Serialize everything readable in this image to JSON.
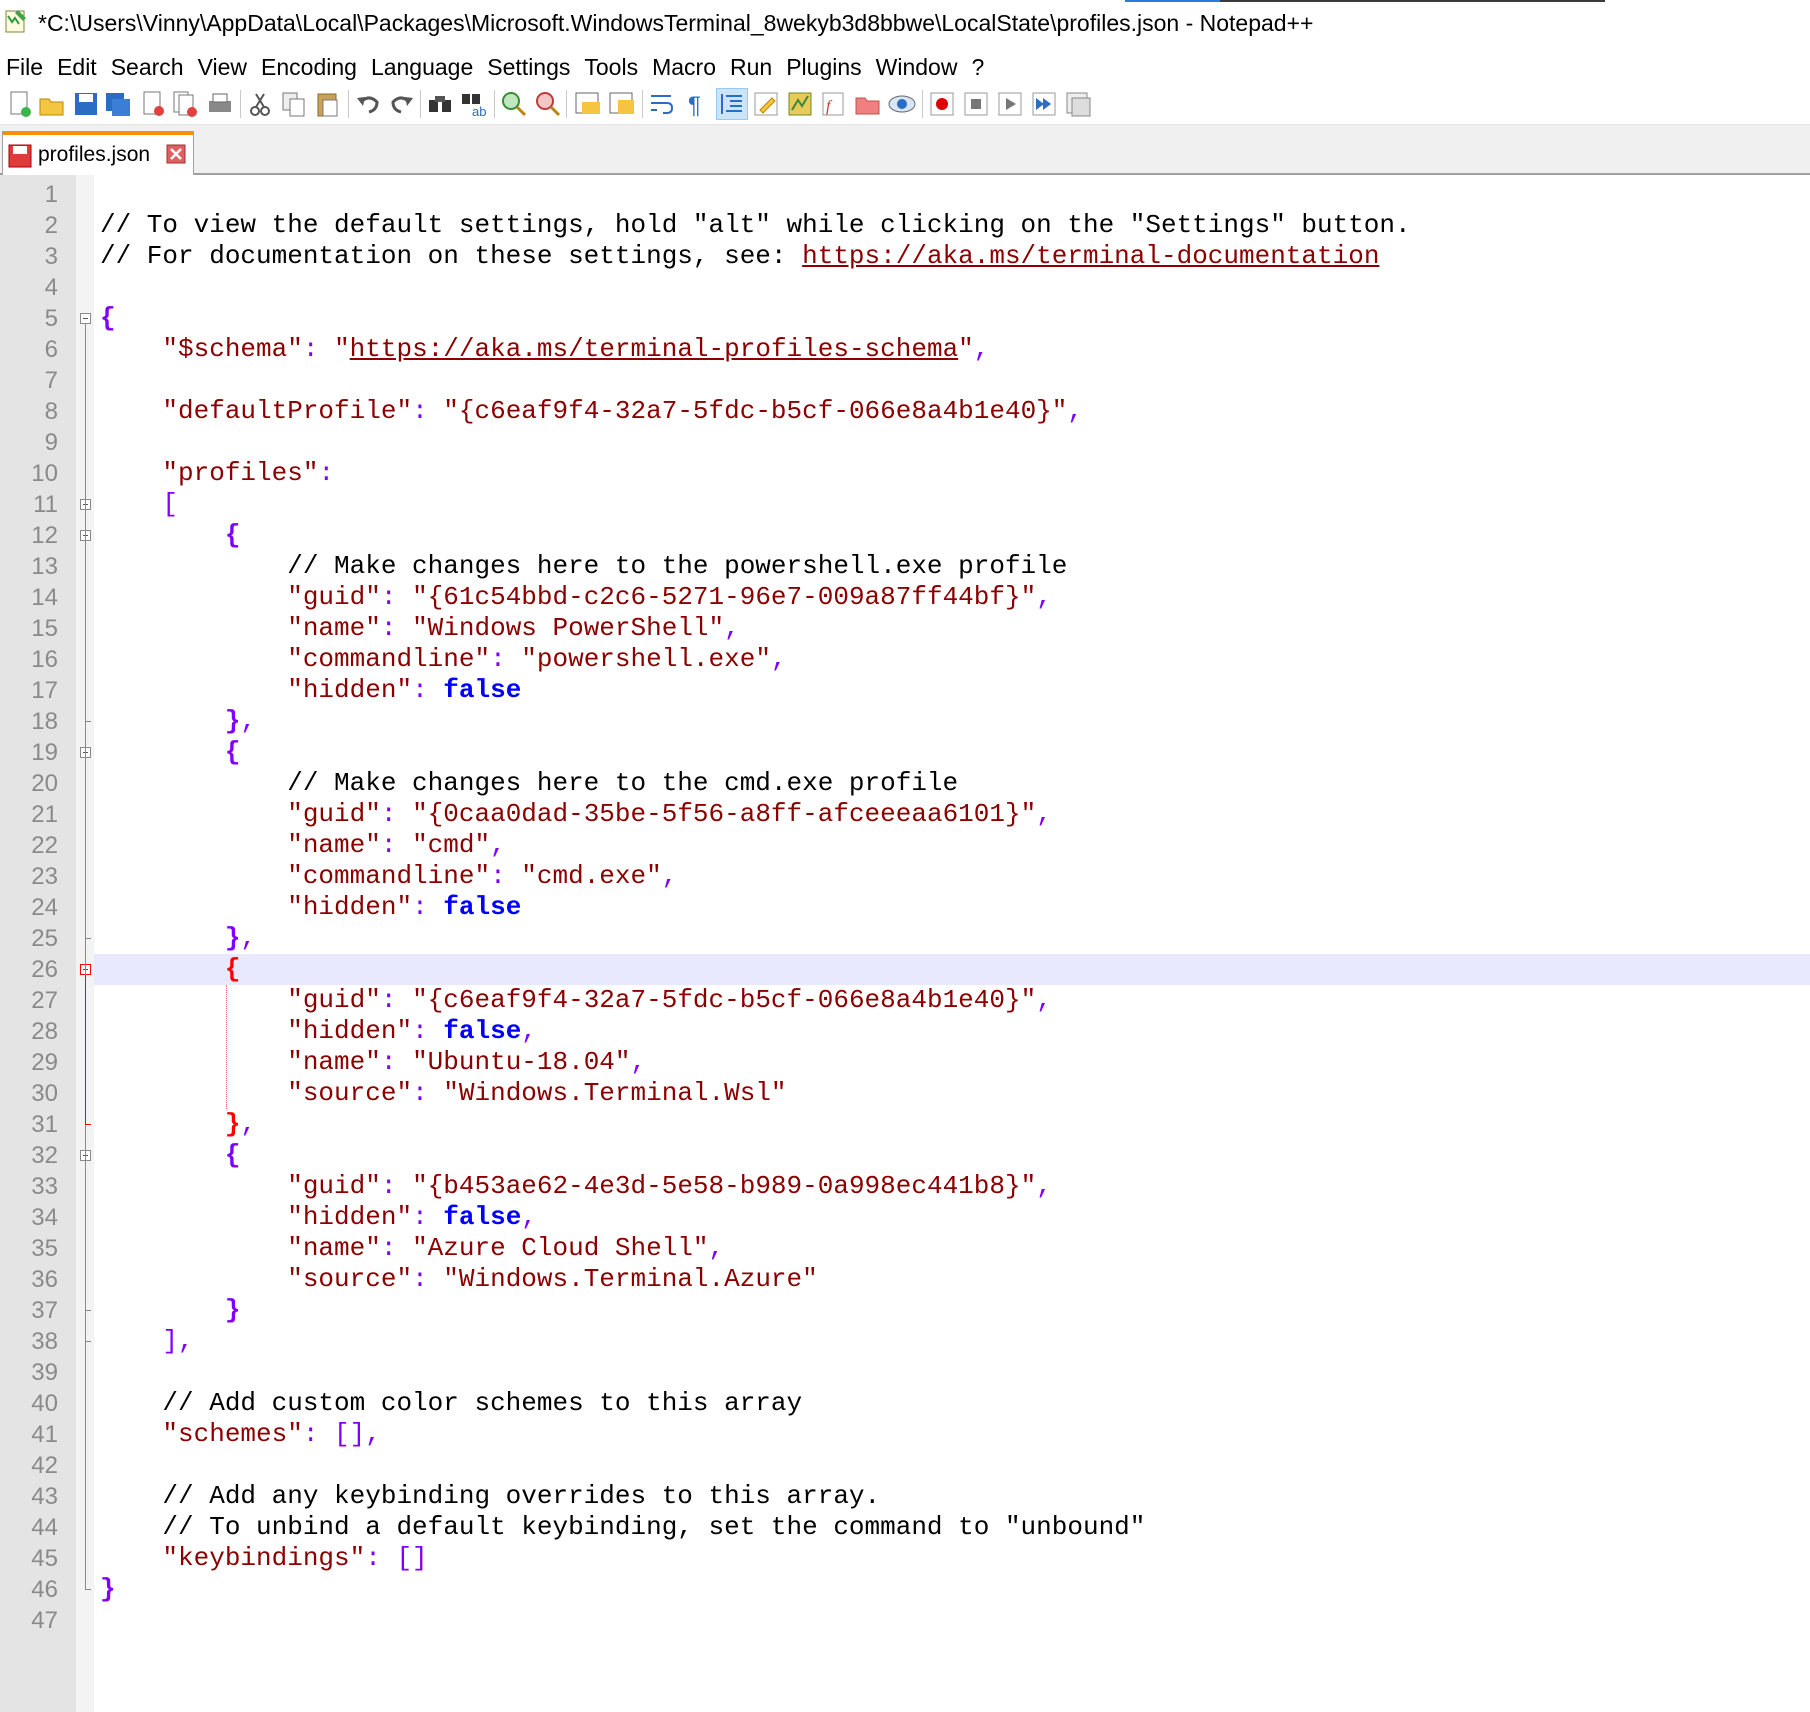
{
  "window": {
    "title": "*C:\\Users\\Vinny\\AppData\\Local\\Packages\\Microsoft.WindowsTerminal_8wekyb3d8bbwe\\LocalState\\profiles.json - Notepad++"
  },
  "menu": [
    {
      "label": "File"
    },
    {
      "label": "Edit"
    },
    {
      "label": "Search"
    },
    {
      "label": "View"
    },
    {
      "label": "Encoding"
    },
    {
      "label": "Language"
    },
    {
      "label": "Settings"
    },
    {
      "label": "Tools"
    },
    {
      "label": "Macro"
    },
    {
      "label": "Run"
    },
    {
      "label": "Plugins"
    },
    {
      "label": "Window"
    },
    {
      "label": "?"
    }
  ],
  "toolbar": {
    "buttons": [
      "new-file-icon",
      "open-file-icon",
      "save-icon",
      "save-all-icon",
      "close-icon",
      "close-all-icon",
      "print-icon",
      "cut-icon",
      "copy-icon",
      "paste-icon",
      "undo-icon",
      "redo-icon",
      "find-icon",
      "replace-icon",
      "zoom-in-icon",
      "zoom-out-icon",
      "sync-vertical-icon",
      "sync-horizontal-icon",
      "word-wrap-icon",
      "show-all-chars-icon",
      "indent-guide-icon",
      "udl-icon",
      "document-map-icon",
      "function-list-icon",
      "folder-workspace-icon",
      "monitoring-icon",
      "record-macro-icon",
      "stop-record-icon",
      "play-macro-icon",
      "run-macro-multiple-icon",
      "save-macro-icon"
    ],
    "active": "indent-guide-icon"
  },
  "tab": {
    "label": "profiles.json"
  },
  "editor": {
    "current_line": 26,
    "lines": [
      {
        "n": "1",
        "tokens": []
      },
      {
        "n": "2",
        "tokens": [
          {
            "t": "// To view the default settings, hold \"alt\" while clicking on the \"Settings\" button.",
            "c": "c-comment"
          }
        ]
      },
      {
        "n": "3",
        "tokens": [
          {
            "t": "// For documentation on these settings, see: ",
            "c": "c-comment"
          },
          {
            "t": "https://aka.ms/terminal-documentation",
            "c": "c-link"
          }
        ]
      },
      {
        "n": "4",
        "tokens": []
      },
      {
        "n": "5",
        "tokens": [
          {
            "t": "{",
            "c": "c-brace"
          }
        ]
      },
      {
        "n": "6",
        "tokens": [
          {
            "t": "    \"$schema\"",
            "c": "c-key"
          },
          {
            "t": ": ",
            "c": "c-op"
          },
          {
            "t": "\"",
            "c": "c-str"
          },
          {
            "t": "https://aka.ms/terminal-profiles-schema",
            "c": "c-link"
          },
          {
            "t": "\"",
            "c": "c-str"
          },
          {
            "t": ",",
            "c": "c-op"
          }
        ]
      },
      {
        "n": "7",
        "tokens": []
      },
      {
        "n": "8",
        "tokens": [
          {
            "t": "    \"defaultProfile\"",
            "c": "c-key"
          },
          {
            "t": ": ",
            "c": "c-op"
          },
          {
            "t": "\"{c6eaf9f4-32a7-5fdc-b5cf-066e8a4b1e40}\"",
            "c": "c-str"
          },
          {
            "t": ",",
            "c": "c-op"
          }
        ]
      },
      {
        "n": "9",
        "tokens": []
      },
      {
        "n": "10",
        "tokens": [
          {
            "t": "    \"profiles\"",
            "c": "c-key"
          },
          {
            "t": ":",
            "c": "c-op"
          }
        ]
      },
      {
        "n": "11",
        "tokens": [
          {
            "t": "    [",
            "c": "c-op"
          }
        ]
      },
      {
        "n": "12",
        "tokens": [
          {
            "t": "        {",
            "c": "c-brace"
          }
        ]
      },
      {
        "n": "13",
        "tokens": [
          {
            "t": "            // Make changes here to the powershell.exe profile",
            "c": "c-comment"
          }
        ]
      },
      {
        "n": "14",
        "tokens": [
          {
            "t": "            \"guid\"",
            "c": "c-key"
          },
          {
            "t": ": ",
            "c": "c-op"
          },
          {
            "t": "\"{61c54bbd-c2c6-5271-96e7-009a87ff44bf}\"",
            "c": "c-str"
          },
          {
            "t": ",",
            "c": "c-op"
          }
        ]
      },
      {
        "n": "15",
        "tokens": [
          {
            "t": "            \"name\"",
            "c": "c-key"
          },
          {
            "t": ": ",
            "c": "c-op"
          },
          {
            "t": "\"Windows PowerShell\"",
            "c": "c-str"
          },
          {
            "t": ",",
            "c": "c-op"
          }
        ]
      },
      {
        "n": "16",
        "tokens": [
          {
            "t": "            \"commandline\"",
            "c": "c-key"
          },
          {
            "t": ": ",
            "c": "c-op"
          },
          {
            "t": "\"powershell.exe\"",
            "c": "c-str"
          },
          {
            "t": ",",
            "c": "c-op"
          }
        ]
      },
      {
        "n": "17",
        "tokens": [
          {
            "t": "            \"hidden\"",
            "c": "c-key"
          },
          {
            "t": ": ",
            "c": "c-op"
          },
          {
            "t": "false",
            "c": "c-bool"
          }
        ]
      },
      {
        "n": "18",
        "tokens": [
          {
            "t": "        }",
            "c": "c-brace"
          },
          {
            "t": ",",
            "c": "c-op"
          }
        ]
      },
      {
        "n": "19",
        "tokens": [
          {
            "t": "        {",
            "c": "c-brace"
          }
        ]
      },
      {
        "n": "20",
        "tokens": [
          {
            "t": "            // Make changes here to the cmd.exe profile",
            "c": "c-comment"
          }
        ]
      },
      {
        "n": "21",
        "tokens": [
          {
            "t": "            \"guid\"",
            "c": "c-key"
          },
          {
            "t": ": ",
            "c": "c-op"
          },
          {
            "t": "\"{0caa0dad-35be-5f56-a8ff-afceeeaa6101}\"",
            "c": "c-str"
          },
          {
            "t": ",",
            "c": "c-op"
          }
        ]
      },
      {
        "n": "22",
        "tokens": [
          {
            "t": "            \"name\"",
            "c": "c-key"
          },
          {
            "t": ": ",
            "c": "c-op"
          },
          {
            "t": "\"cmd\"",
            "c": "c-str"
          },
          {
            "t": ",",
            "c": "c-op"
          }
        ]
      },
      {
        "n": "23",
        "tokens": [
          {
            "t": "            \"commandline\"",
            "c": "c-key"
          },
          {
            "t": ": ",
            "c": "c-op"
          },
          {
            "t": "\"cmd.exe\"",
            "c": "c-str"
          },
          {
            "t": ",",
            "c": "c-op"
          }
        ]
      },
      {
        "n": "24",
        "tokens": [
          {
            "t": "            \"hidden\"",
            "c": "c-key"
          },
          {
            "t": ": ",
            "c": "c-op"
          },
          {
            "t": "false",
            "c": "c-bool"
          }
        ]
      },
      {
        "n": "25",
        "tokens": [
          {
            "t": "        }",
            "c": "c-brace"
          },
          {
            "t": ",",
            "c": "c-op"
          }
        ]
      },
      {
        "n": "26",
        "tokens": [
          {
            "t": "        {",
            "c": "c-brace-red"
          }
        ]
      },
      {
        "n": "27",
        "tokens": [
          {
            "t": "            \"guid\"",
            "c": "c-key"
          },
          {
            "t": ": ",
            "c": "c-op"
          },
          {
            "t": "\"{c6eaf9f4-32a7-5fdc-b5cf-066e8a4b1e40}\"",
            "c": "c-str"
          },
          {
            "t": ",",
            "c": "c-op"
          }
        ]
      },
      {
        "n": "28",
        "tokens": [
          {
            "t": "            \"hidden\"",
            "c": "c-key"
          },
          {
            "t": ": ",
            "c": "c-op"
          },
          {
            "t": "false",
            "c": "c-bool"
          },
          {
            "t": ",",
            "c": "c-op"
          }
        ]
      },
      {
        "n": "29",
        "tokens": [
          {
            "t": "            \"name\"",
            "c": "c-key"
          },
          {
            "t": ": ",
            "c": "c-op"
          },
          {
            "t": "\"Ubuntu-18.04\"",
            "c": "c-str"
          },
          {
            "t": ",",
            "c": "c-op"
          }
        ]
      },
      {
        "n": "30",
        "tokens": [
          {
            "t": "            \"source\"",
            "c": "c-key"
          },
          {
            "t": ": ",
            "c": "c-op"
          },
          {
            "t": "\"Windows.Terminal.Wsl\"",
            "c": "c-str"
          }
        ]
      },
      {
        "n": "31",
        "tokens": [
          {
            "t": "        }",
            "c": "c-brace-red"
          },
          {
            "t": ",",
            "c": "c-op"
          }
        ]
      },
      {
        "n": "32",
        "tokens": [
          {
            "t": "        {",
            "c": "c-brace"
          }
        ]
      },
      {
        "n": "33",
        "tokens": [
          {
            "t": "            \"guid\"",
            "c": "c-key"
          },
          {
            "t": ": ",
            "c": "c-op"
          },
          {
            "t": "\"{b453ae62-4e3d-5e58-b989-0a998ec441b8}\"",
            "c": "c-str"
          },
          {
            "t": ",",
            "c": "c-op"
          }
        ]
      },
      {
        "n": "34",
        "tokens": [
          {
            "t": "            \"hidden\"",
            "c": "c-key"
          },
          {
            "t": ": ",
            "c": "c-op"
          },
          {
            "t": "false",
            "c": "c-bool"
          },
          {
            "t": ",",
            "c": "c-op"
          }
        ]
      },
      {
        "n": "35",
        "tokens": [
          {
            "t": "            \"name\"",
            "c": "c-key"
          },
          {
            "t": ": ",
            "c": "c-op"
          },
          {
            "t": "\"Azure Cloud Shell\"",
            "c": "c-str"
          },
          {
            "t": ",",
            "c": "c-op"
          }
        ]
      },
      {
        "n": "36",
        "tokens": [
          {
            "t": "            \"source\"",
            "c": "c-key"
          },
          {
            "t": ": ",
            "c": "c-op"
          },
          {
            "t": "\"Windows.Terminal.Azure\"",
            "c": "c-str"
          }
        ]
      },
      {
        "n": "37",
        "tokens": [
          {
            "t": "        }",
            "c": "c-brace"
          }
        ]
      },
      {
        "n": "38",
        "tokens": [
          {
            "t": "    ],",
            "c": "c-op"
          }
        ]
      },
      {
        "n": "39",
        "tokens": []
      },
      {
        "n": "40",
        "tokens": [
          {
            "t": "    // Add custom color schemes to this array",
            "c": "c-comment"
          }
        ]
      },
      {
        "n": "41",
        "tokens": [
          {
            "t": "    \"schemes\"",
            "c": "c-key"
          },
          {
            "t": ": [],",
            "c": "c-op"
          }
        ]
      },
      {
        "n": "42",
        "tokens": []
      },
      {
        "n": "43",
        "tokens": [
          {
            "t": "    // Add any keybinding overrides to this array.",
            "c": "c-comment"
          }
        ]
      },
      {
        "n": "44",
        "tokens": [
          {
            "t": "    // To unbind a default keybinding, set the command to \"unbound\"",
            "c": "c-comment"
          }
        ]
      },
      {
        "n": "45",
        "tokens": [
          {
            "t": "    \"keybindings\"",
            "c": "c-key"
          },
          {
            "t": ": []",
            "c": "c-op"
          }
        ]
      },
      {
        "n": "46",
        "tokens": [
          {
            "t": "}",
            "c": "c-brace"
          }
        ]
      },
      {
        "n": "47",
        "tokens": []
      }
    ]
  }
}
